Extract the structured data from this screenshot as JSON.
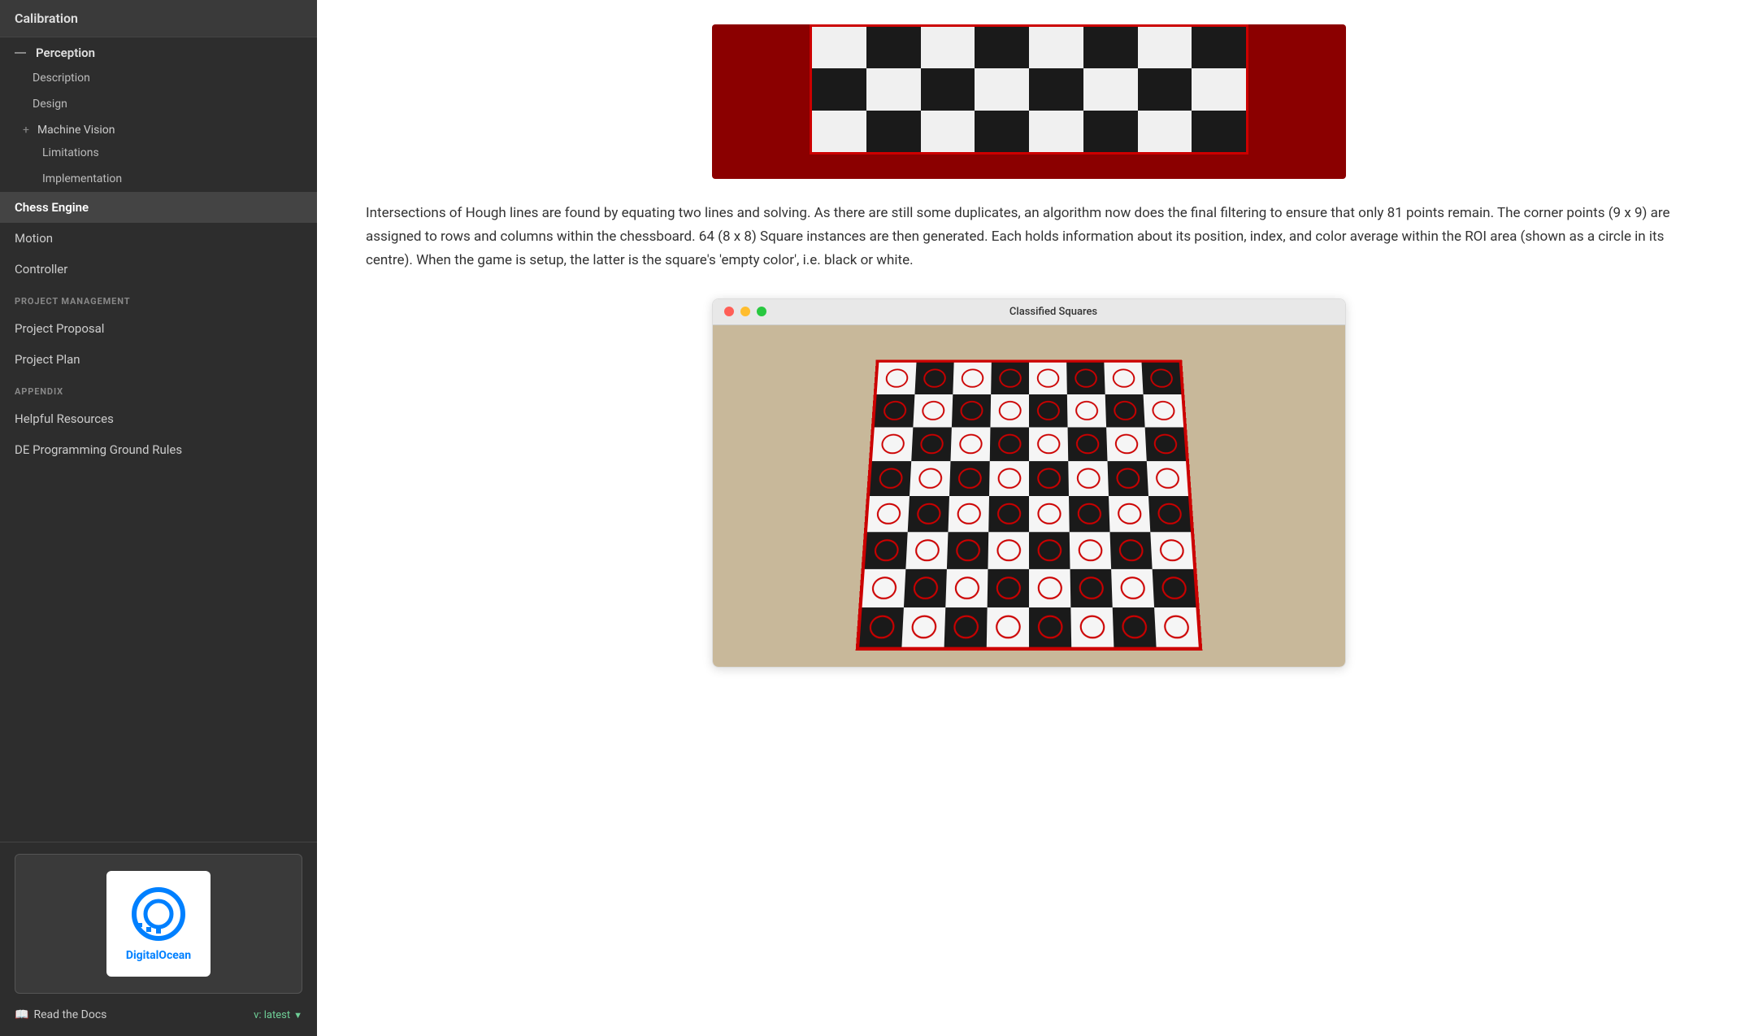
{
  "sidebar": {
    "calibration_label": "Calibration",
    "perception_label": "Perception",
    "description_label": "Description",
    "design_label": "Design",
    "machine_vision_label": "Machine Vision",
    "limitations_label": "Limitations",
    "implementation_label": "Implementation",
    "chess_engine_label": "Chess Engine",
    "motion_label": "Motion",
    "controller_label": "Controller",
    "project_management_label": "PROJECT MANAGEMENT",
    "project_proposal_label": "Project Proposal",
    "project_plan_label": "Project Plan",
    "appendix_label": "APPENDIX",
    "helpful_resources_label": "Helpful Resources",
    "de_programming_label": "DE Programming Ground Rules",
    "do_logo_text": "DigitalOcean",
    "read_docs_label": "Read the Docs",
    "version_label": "v: latest"
  },
  "main": {
    "paragraph": "Intersections of Hough lines are found by equating two lines and solving. As there are still some duplicates, an algorithm now does the final filtering to ensure that only 81 points remain. The corner points (9 x 9) are assigned to rows and columns within the chessboard. 64 (8 x 8) Square instances are then generated. Each holds information about its position, index, and color average within the ROI area (shown as a circle in its centre). When the game is setup, the latter is the square's 'empty color', i.e. black or white.",
    "window_title": "Classified Squares"
  },
  "colors": {
    "sidebar_bg": "#2d2d2d",
    "active_item": "#444",
    "board_red": "#8b0000",
    "accent_green": "#6fcf97"
  },
  "chessboard_top": {
    "rows": 3,
    "cols": 8
  },
  "classified_board": {
    "rows": 8,
    "cols": 8
  }
}
